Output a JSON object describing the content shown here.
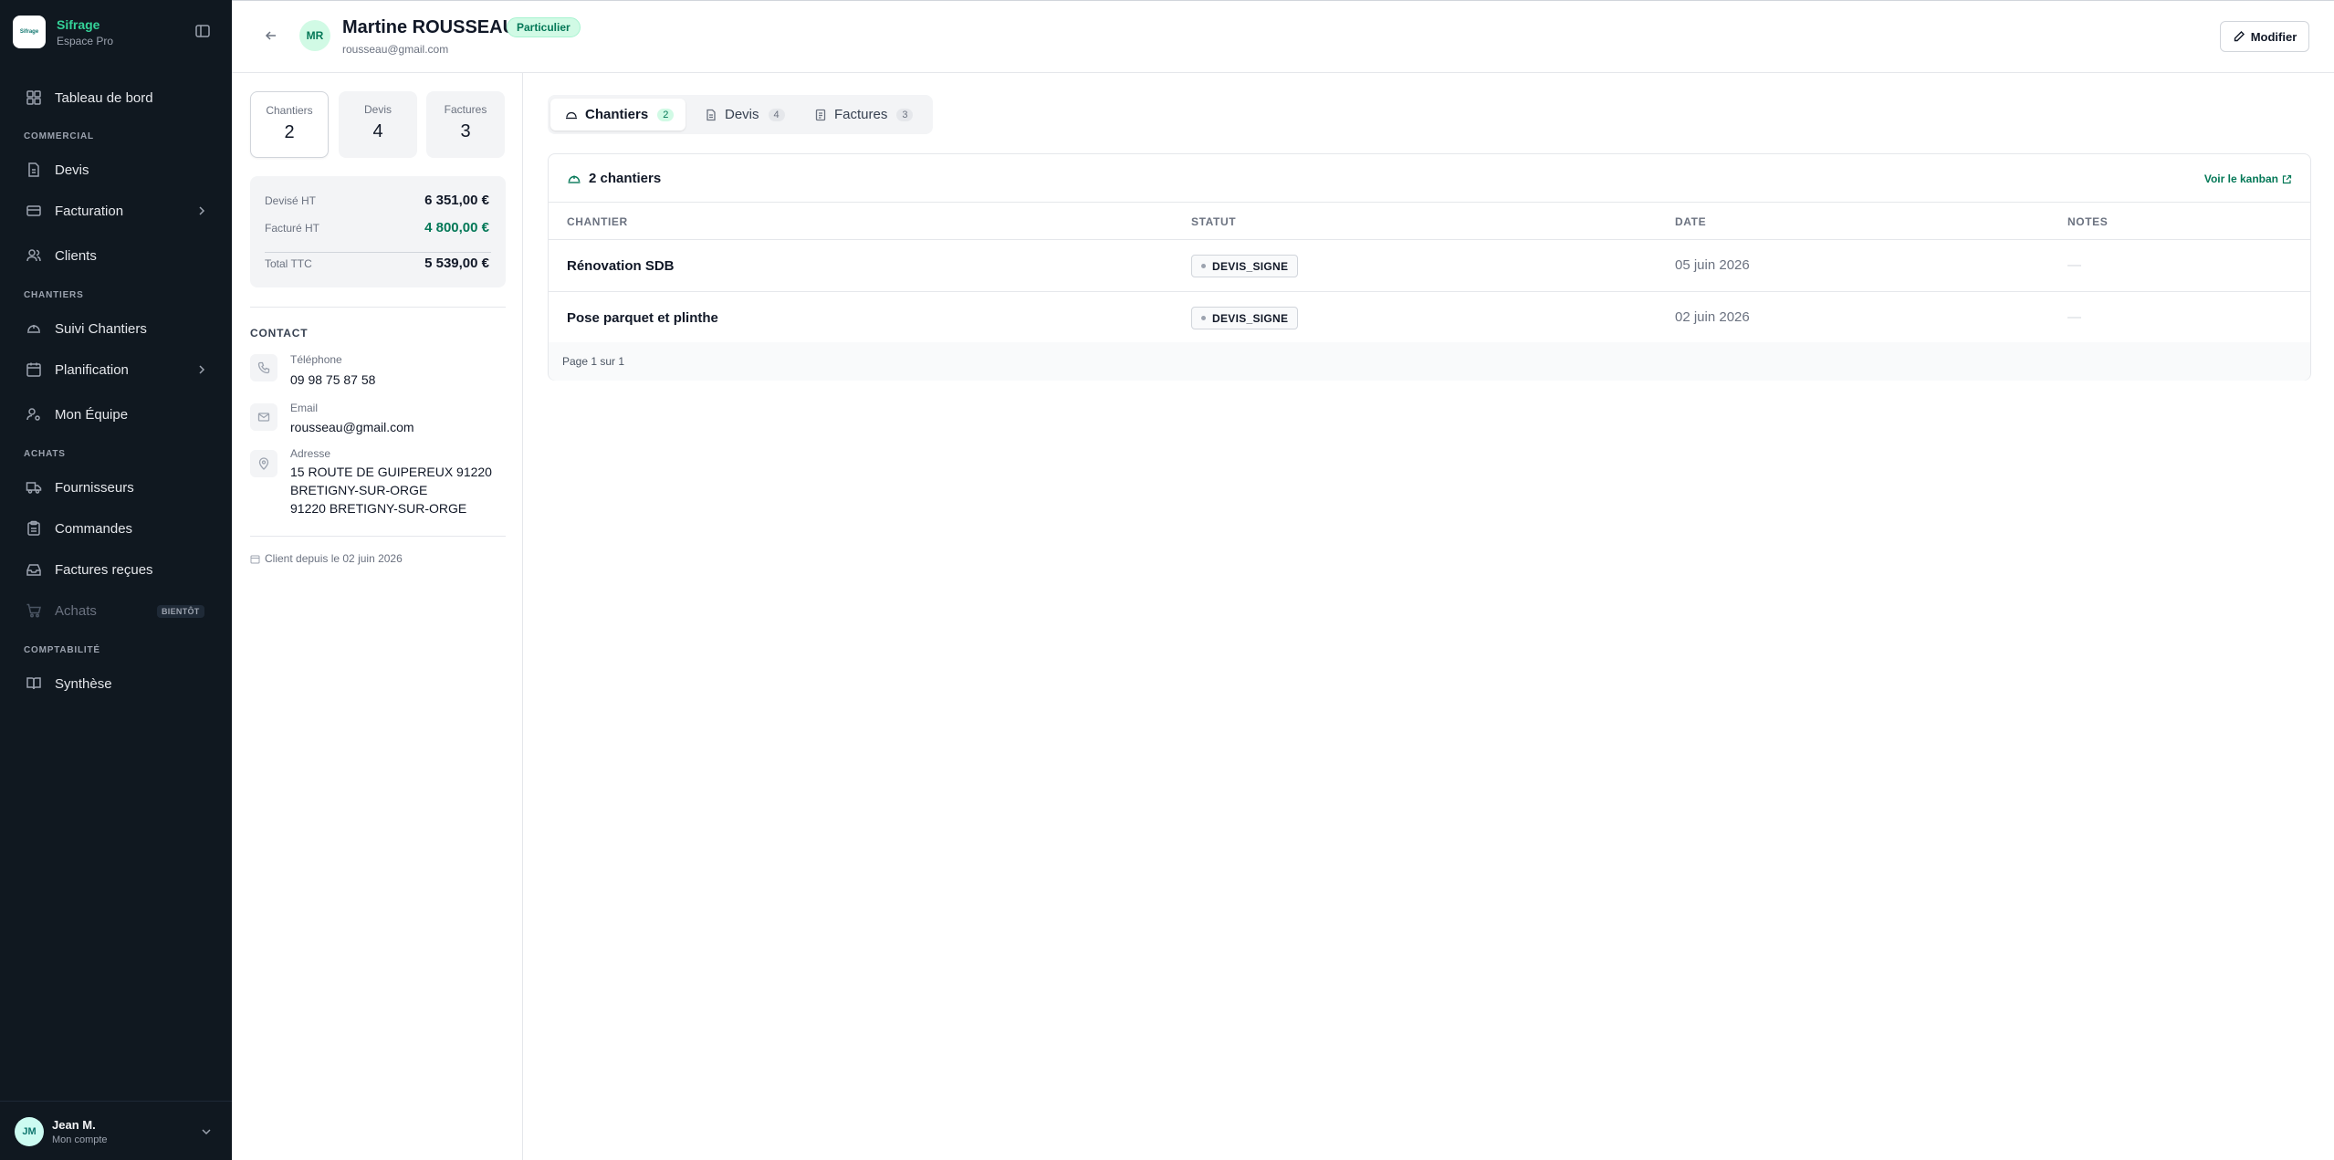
{
  "brand": {
    "name": "Sifrage",
    "subtitle": "Espace Pro",
    "logo_text": "Sifrage"
  },
  "sidebar": {
    "dashboard": "Tableau de bord",
    "sections": {
      "commercial": "COMMERCIAL",
      "chantiers": "CHANTIERS",
      "achats": "ACHATS",
      "comptabilite": "COMPTABILITÉ"
    },
    "items": {
      "devis": "Devis",
      "facturation": "Facturation",
      "clients": "Clients",
      "suivi": "Suivi Chantiers",
      "planification": "Planification",
      "equipe": "Mon Équipe",
      "fournisseurs": "Fournisseurs",
      "commandes": "Commandes",
      "factures_recues": "Factures reçues",
      "achats": "Achats",
      "synthese": "Synthèse"
    },
    "soon_badge": "BIENTÔT"
  },
  "user": {
    "initials": "JM",
    "name": "Jean M.",
    "subtitle": "Mon compte"
  },
  "client": {
    "initials": "MR",
    "name": "Martine ROUSSEAU",
    "type": "Particulier",
    "email": "rousseau@gmail.com"
  },
  "header": {
    "edit_label": "Modifier"
  },
  "stats": [
    {
      "label": "Chantiers",
      "value": "2"
    },
    {
      "label": "Devis",
      "value": "4"
    },
    {
      "label": "Factures",
      "value": "3"
    }
  ],
  "totals": {
    "devise_label": "Devisé HT",
    "devise_value": "6 351,00 €",
    "facture_label": "Facturé HT",
    "facture_value": "4 800,00 €",
    "ttc_label": "Total TTC",
    "ttc_value": "5 539,00 €"
  },
  "contact": {
    "title": "CONTACT",
    "phone_label": "Téléphone",
    "phone": "09 98 75 87 58",
    "email_label": "Email",
    "email": "rousseau@gmail.com",
    "address_label": "Adresse",
    "address_line1": "15 ROUTE DE GUIPEREUX 91220",
    "address_line2": "BRETIGNY-SUR-ORGE",
    "address_line3": "91220 BRETIGNY-SUR-ORGE"
  },
  "client_since": "Client depuis le 02 juin 2026",
  "tabs": [
    {
      "label": "Chantiers",
      "count": "2",
      "active": true
    },
    {
      "label": "Devis",
      "count": "4",
      "active": false
    },
    {
      "label": "Factures",
      "count": "3",
      "active": false
    }
  ],
  "table": {
    "title": "2 chantiers",
    "kanban_link": "Voir le kanban",
    "columns": [
      "CHANTIER",
      "STATUT",
      "DATE",
      "NOTES"
    ],
    "rows": [
      {
        "name": "Rénovation SDB",
        "status": "DEVIS_SIGNE",
        "date": "05 juin 2026",
        "notes": "—"
      },
      {
        "name": "Pose parquet et plinthe",
        "status": "DEVIS_SIGNE",
        "date": "02 juin 2026",
        "notes": "—"
      }
    ],
    "pagination": "Page 1 sur 1"
  },
  "colors": {
    "accent": "#047857",
    "sidebar_bg": "#101820",
    "accent_light": "#d1fae5"
  }
}
